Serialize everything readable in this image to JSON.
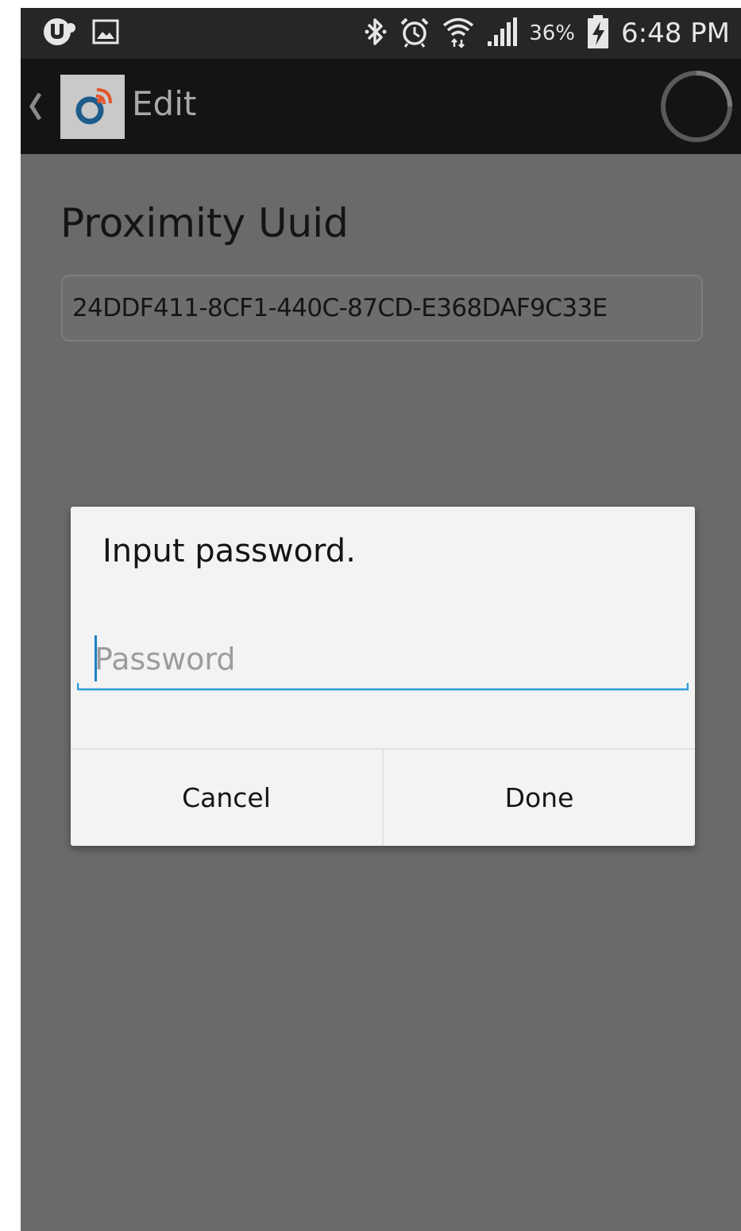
{
  "status_bar": {
    "battery_percent": "36%",
    "time": "6:48 PM",
    "icons": [
      "notification-app-icon",
      "gallery-notification-icon",
      "bluetooth-icon",
      "alarm-icon",
      "wifi-icon",
      "signal-icon",
      "battery-charging-icon"
    ]
  },
  "action_bar": {
    "title": "Edit",
    "icons": [
      "back-chevron-icon",
      "app-logo-icon",
      "loading-spinner-icon"
    ]
  },
  "content": {
    "section_title": "Proximity Uuid",
    "uuid_value": "24DDF411-8CF1-440C-87CD-E368DAF9C33E"
  },
  "dialog": {
    "title": "Input password.",
    "password_placeholder": "Password",
    "password_value": "",
    "cancel_label": "Cancel",
    "done_label": "Done"
  },
  "colors": {
    "accent": "#1e7fc4",
    "status_bar": "#262626",
    "action_bar": "#141414",
    "dim_overlay": "#6a6a6a",
    "dialog_bg": "#f3f3f3"
  }
}
